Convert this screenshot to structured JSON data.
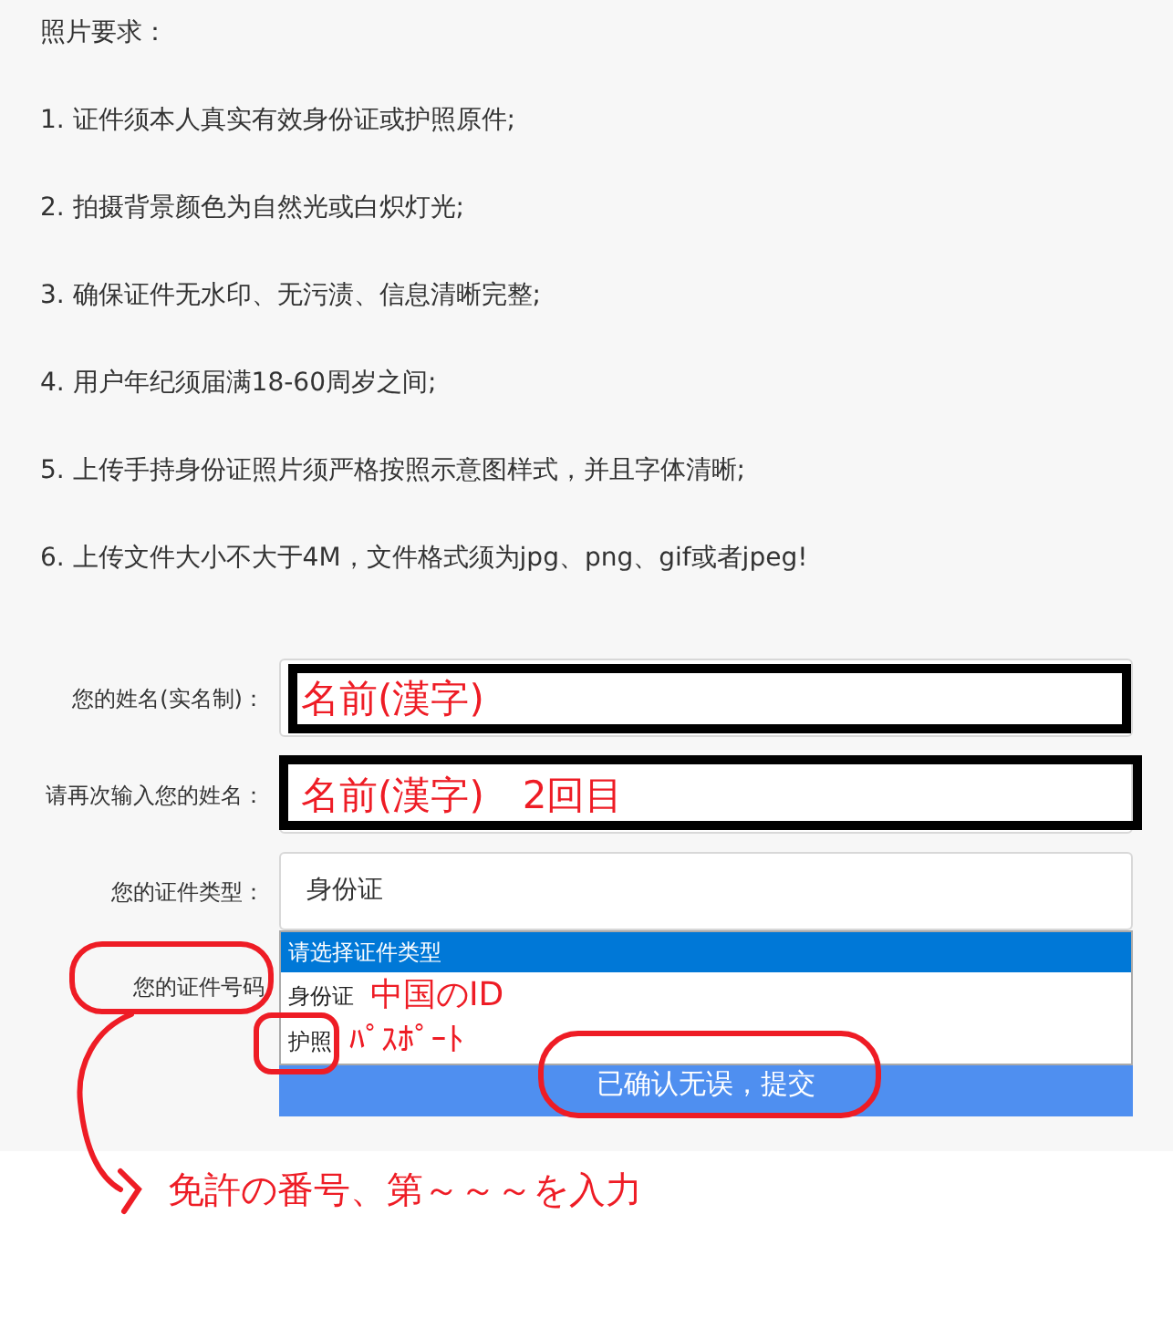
{
  "requirements": {
    "title": "照片要求：",
    "items": [
      "1. 证件须本人真实有效身份证或护照原件;",
      "2. 拍摄背景颜色为自然光或白炽灯光;",
      "3. 确保证件无水印、无污渍、信息清晰完整;",
      "4. 用户年纪须届满18-60周岁之间;",
      "5. 上传手持身份证照片须严格按照示意图样式，并且字体清晰;",
      "6. 上传文件大小不大于4M，文件格式须为jpg、png、gif或者jpeg!"
    ]
  },
  "form": {
    "fields": [
      {
        "kind": "text",
        "label": "您的姓名(实名制)：",
        "annotation": "名前(漢字)",
        "framed": true
      },
      {
        "kind": "text",
        "label": "请再次输入您的姓名：",
        "annotation": "名前(漢字)　2回目",
        "framed": true
      },
      {
        "kind": "select",
        "label": "您的证件类型：",
        "value": "身份证",
        "options": [
          {
            "label": "请选择证件类型",
            "highlighted": true
          },
          {
            "label": "身份证",
            "highlighted": false,
            "annotation": "中国のID"
          },
          {
            "label": "护照",
            "highlighted": false,
            "annotation": "ﾊﾟｽﾎﾟｰﾄ"
          }
        ]
      },
      {
        "kind": "hidden",
        "label": "您的证件号码"
      }
    ],
    "submit": "已确认无误，提交"
  },
  "note": "免許の番号、第～～～を入力"
}
